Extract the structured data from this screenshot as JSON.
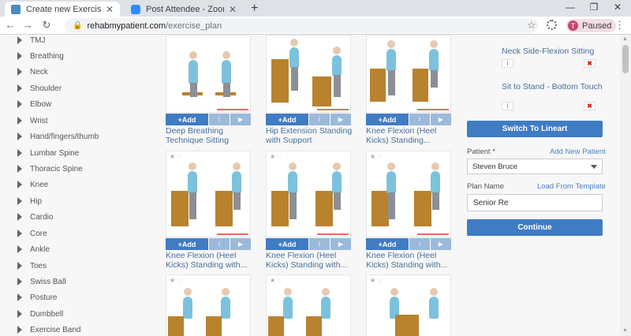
{
  "browser": {
    "tabs": [
      {
        "title": "Create new Exercise Plan | Rehab",
        "active": true
      },
      {
        "title": "Post Attendee - Zoom",
        "active": false
      }
    ],
    "new_tab": "+",
    "url_host": "rehabmypatient.com",
    "url_path": "/exercise_plan",
    "profile_initial": "T",
    "profile_status": "Paused"
  },
  "sidebar": {
    "categories": [
      "TMJ",
      "Breathing",
      "Neck",
      "Shoulder",
      "Elbow",
      "Wrist",
      "Hand/fingers/thumb",
      "Lumbar Spine",
      "Thoracic Spine",
      "Knee",
      "Hip",
      "Cardio",
      "Core",
      "Ankle",
      "Toes",
      "Swiss Ball",
      "Posture",
      "Dumbbell",
      "Exercise Band"
    ]
  },
  "exercises": {
    "add_label": "+Add",
    "info_icon": "i",
    "play_icon": "▶",
    "items": [
      {
        "title": "Deep Breathing Technique Sitting"
      },
      {
        "title": "Hip Extension Standing with Support"
      },
      {
        "title": "Knee Flexion (Heel Kicks) Standing..."
      },
      {
        "title": "Knee Flexion (Heel Kicks) Standing with..."
      },
      {
        "title": "Knee Flexion (Heel Kicks) Standing with..."
      },
      {
        "title": "Knee Flexion (Heel Kicks) Standing with..."
      }
    ]
  },
  "selected": {
    "items": [
      {
        "name": "Neck Side-Flexion Sitting"
      },
      {
        "name": "Sit to Stand - Bottom Touch"
      }
    ],
    "info_icon": "i",
    "delete_icon": "✖"
  },
  "form": {
    "switch_label": "Switch To Lineart",
    "patient_label": "Patient *",
    "add_patient_link": "Add New Patient",
    "patient_value": "Steven Bruce",
    "plan_name_label": "Plan Name",
    "load_template_link": "Load From Template",
    "plan_name_value": "Senior Re",
    "continue_label": "Continue"
  },
  "colors": {
    "accent": "#3f7cc3",
    "link": "#4a6e9a",
    "delete": "#d9261c"
  }
}
